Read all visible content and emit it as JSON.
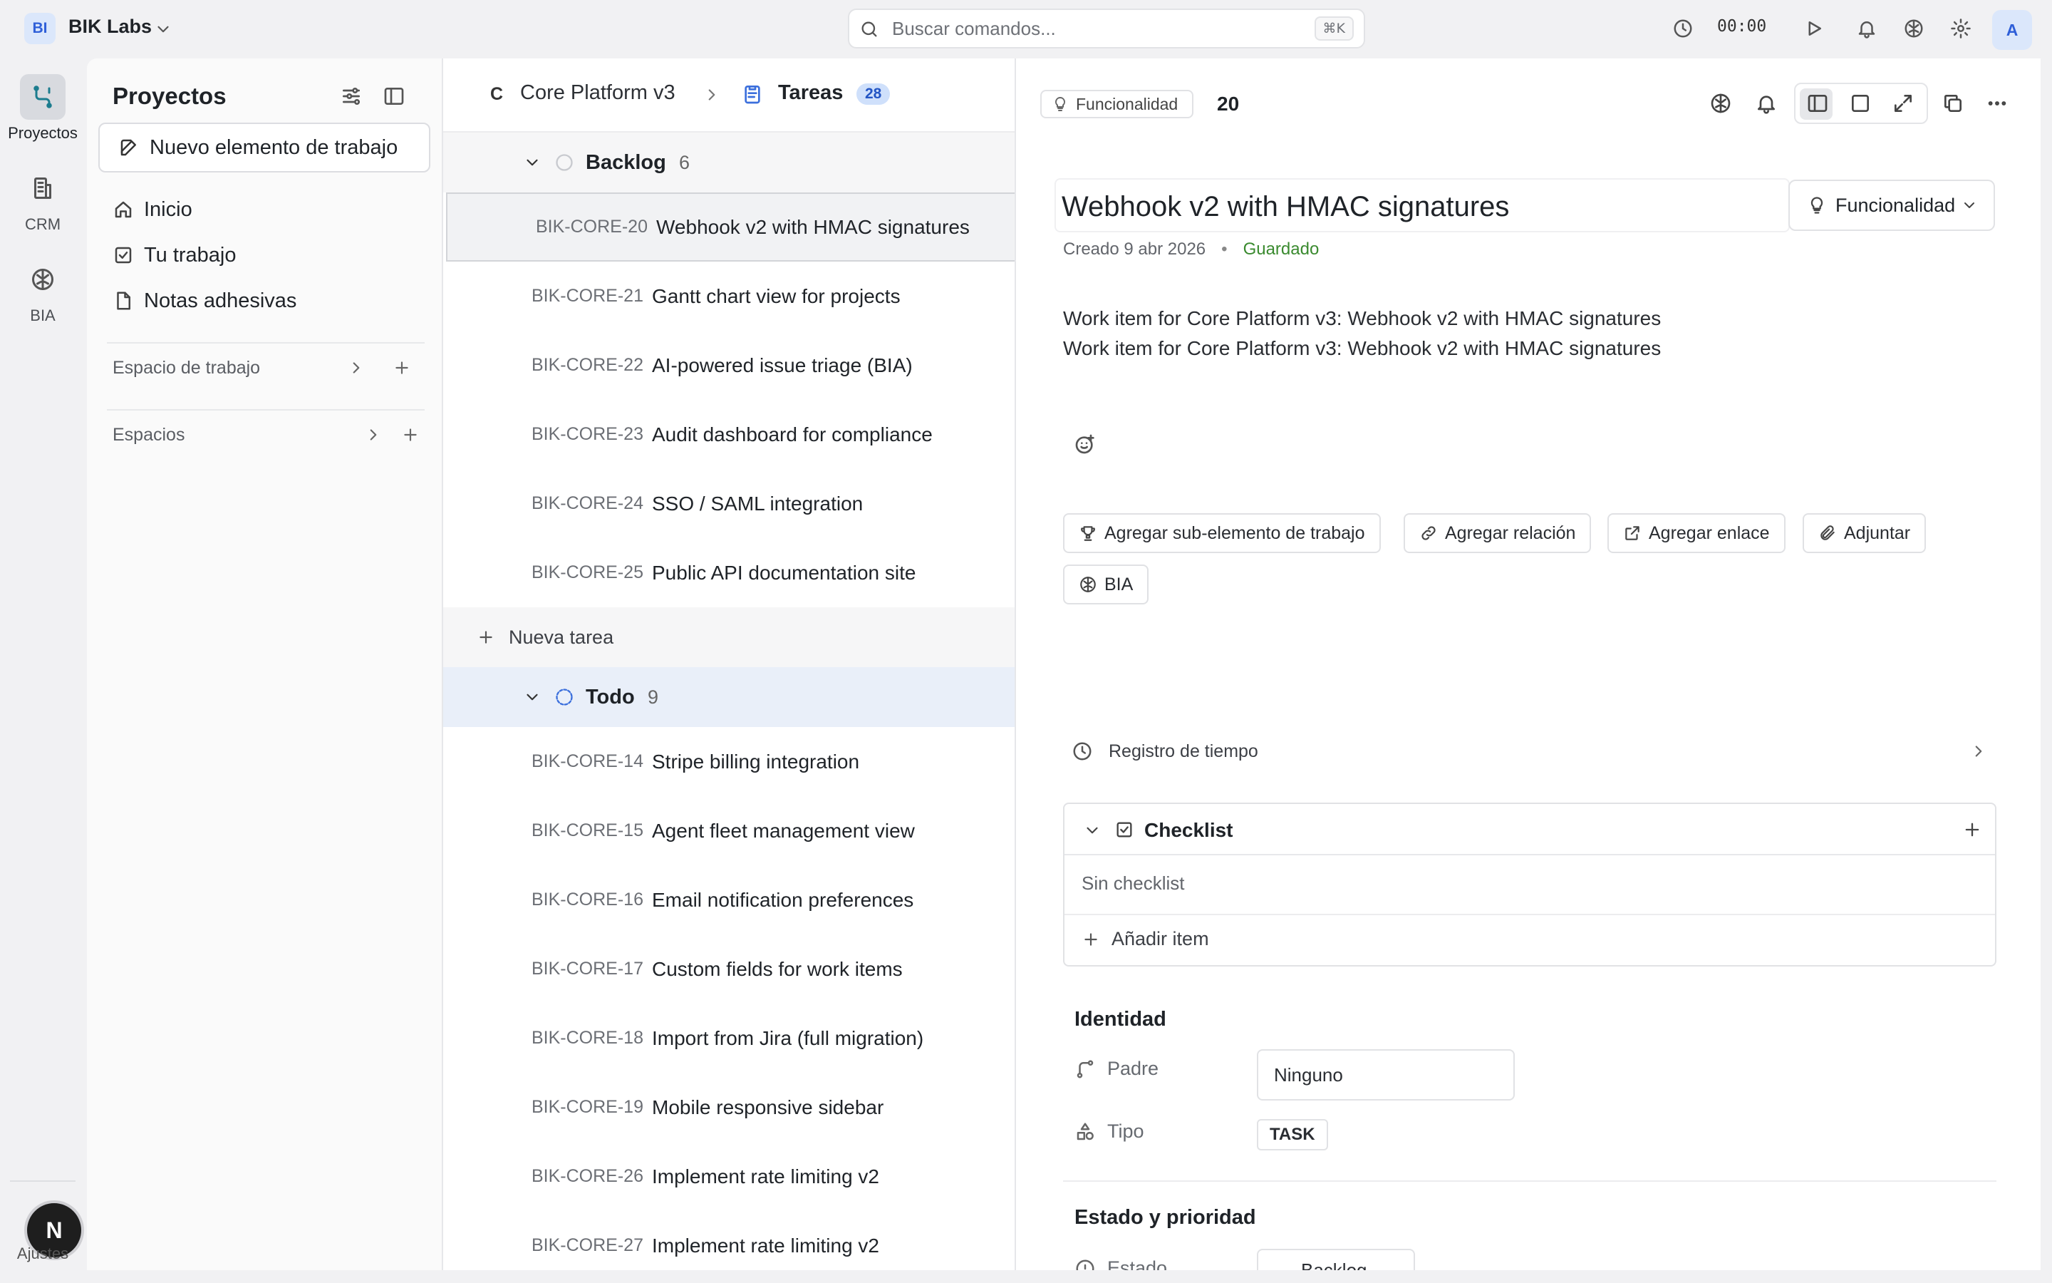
{
  "workspace": {
    "avatar": "BI",
    "name": "BIK Labs"
  },
  "search": {
    "placeholder": "Buscar comandos...",
    "shortcut": "⌘K"
  },
  "topbar": {
    "timer": "00:00",
    "user_avatar": "A"
  },
  "rail": {
    "items": [
      {
        "label": "Proyectos",
        "icon": "projects-icon",
        "active": true
      },
      {
        "label": "CRM",
        "icon": "building-icon",
        "active": false
      },
      {
        "label": "BIA",
        "icon": "brain-icon",
        "active": false
      }
    ],
    "footer_badge": "N",
    "settings_label": "Ajustes"
  },
  "sidebar": {
    "title": "Proyectos",
    "new_item_label": "Nuevo elemento de trabajo",
    "nav": [
      {
        "label": "Inicio",
        "icon": "home-icon"
      },
      {
        "label": "Tu trabajo",
        "icon": "checkbox-icon"
      },
      {
        "label": "Notas adhesivas",
        "icon": "note-icon"
      }
    ],
    "sections": [
      {
        "label": "Espacio de trabajo"
      },
      {
        "label": "Espacios"
      }
    ]
  },
  "list": {
    "project_initial": "C",
    "project_name": "Core Platform v3",
    "view_name": "Tareas",
    "view_count": "28",
    "groups": [
      {
        "name": "Backlog",
        "count": "6",
        "tasks": [
          {
            "id": "BIK-CORE-20",
            "title": "Webhook v2 with HMAC signatures",
            "selected": true
          },
          {
            "id": "BIK-CORE-21",
            "title": "Gantt chart view for projects"
          },
          {
            "id": "BIK-CORE-22",
            "title": "AI-powered issue triage (BIA)"
          },
          {
            "id": "BIK-CORE-23",
            "title": "Audit dashboard for compliance"
          },
          {
            "id": "BIK-CORE-24",
            "title": "SSO / SAML integration"
          },
          {
            "id": "BIK-CORE-25",
            "title": "Public API documentation site"
          }
        ],
        "new_task_label": "Nueva tarea"
      },
      {
        "name": "Todo",
        "count": "9",
        "tasks": [
          {
            "id": "BIK-CORE-14",
            "title": "Stripe billing integration"
          },
          {
            "id": "BIK-CORE-15",
            "title": "Agent fleet management view"
          },
          {
            "id": "BIK-CORE-16",
            "title": "Email notification preferences"
          },
          {
            "id": "BIK-CORE-17",
            "title": "Custom fields for work items"
          },
          {
            "id": "BIK-CORE-18",
            "title": "Import from Jira (full migration)"
          },
          {
            "id": "BIK-CORE-19",
            "title": "Mobile responsive sidebar"
          },
          {
            "id": "BIK-CORE-26",
            "title": "Implement rate limiting v2"
          },
          {
            "id": "BIK-CORE-27",
            "title": "Implement rate limiting v2"
          }
        ]
      }
    ]
  },
  "detail": {
    "type_pill": "Funcionalidad",
    "number": "20",
    "title": "Webhook v2 with HMAC signatures",
    "type_dropdown": "Funcionalidad",
    "created": "Creado 9 abr 2026",
    "dot": "•",
    "saved": "Guardado",
    "description": [
      "Work item for Core Platform v3: Webhook v2 with HMAC signatures",
      "Work item for Core Platform v3: Webhook v2 with HMAC signatures"
    ],
    "actions": {
      "add_subitem": "Agregar sub-elemento de trabajo",
      "add_relation": "Agregar relación",
      "add_link": "Agregar enlace",
      "attach": "Adjuntar",
      "bia": "BIA"
    },
    "time_log": "Registro de tiempo",
    "checklist": {
      "title": "Checklist",
      "empty": "Sin checklist",
      "add_item": "Añadir item"
    },
    "identity": {
      "title": "Identidad",
      "parent_label": "Padre",
      "parent_value": "Ninguno",
      "type_label": "Tipo",
      "type_value": "TASK"
    },
    "status_priority": {
      "title": "Estado y prioridad",
      "state_label": "Estado",
      "state_value": "Backlog"
    }
  },
  "colors": {
    "accent": "#2f5fd8",
    "count_badge_bg": "#cfe0fb",
    "saved_green": "#3a8a2f",
    "todo_row_bg": "#e9eff9",
    "todo_status": "#3b6fdc"
  }
}
